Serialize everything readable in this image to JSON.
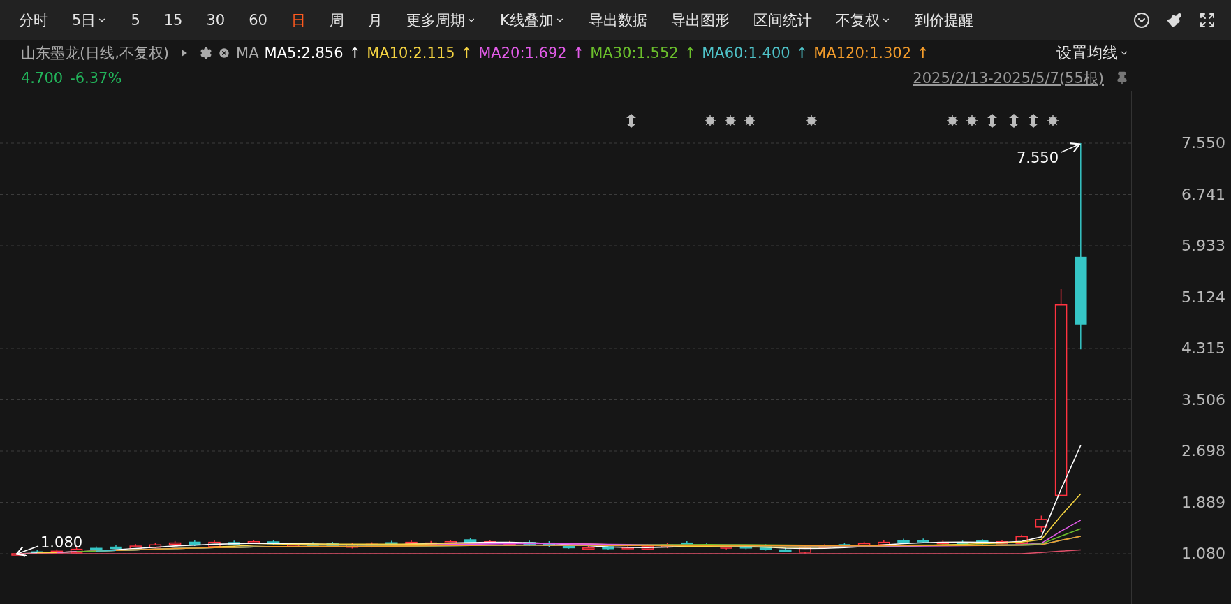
{
  "toolbar": {
    "items": [
      {
        "label": "分时",
        "selected": false,
        "dropdown": false
      },
      {
        "label": "5日",
        "selected": false,
        "dropdown": true
      },
      {
        "label": "5",
        "selected": false,
        "dropdown": false
      },
      {
        "label": "15",
        "selected": false,
        "dropdown": false
      },
      {
        "label": "30",
        "selected": false,
        "dropdown": false
      },
      {
        "label": "60",
        "selected": false,
        "dropdown": false
      },
      {
        "label": "日",
        "selected": true,
        "dropdown": false
      },
      {
        "label": "周",
        "selected": false,
        "dropdown": false
      },
      {
        "label": "月",
        "selected": false,
        "dropdown": false
      },
      {
        "label": "更多周期",
        "selected": false,
        "dropdown": true
      },
      {
        "label": "K线叠加",
        "selected": false,
        "dropdown": true
      },
      {
        "label": "导出数据",
        "selected": false,
        "dropdown": false
      },
      {
        "label": "导出图形",
        "selected": false,
        "dropdown": false
      },
      {
        "label": "区间统计",
        "selected": false,
        "dropdown": false
      },
      {
        "label": "不复权",
        "selected": false,
        "dropdown": true
      },
      {
        "label": "到价提醒",
        "selected": false,
        "dropdown": false
      }
    ]
  },
  "legend": {
    "title": "山东墨龙(日线,不复权)",
    "indicator": "MA",
    "setting": "设置均线",
    "ma": [
      {
        "label": "MA5:2.856",
        "arrow": "↑",
        "color": "#ffffff"
      },
      {
        "label": "MA10:2.115",
        "arrow": "↑",
        "color": "#f5d442"
      },
      {
        "label": "MA20:1.692",
        "arrow": "↑",
        "color": "#e25ce8"
      },
      {
        "label": "MA30:1.552",
        "arrow": "↑",
        "color": "#6bbf2c"
      },
      {
        "label": "MA60:1.400",
        "arrow": "↑",
        "color": "#4fc3c9"
      },
      {
        "label": "MA120:1.302",
        "arrow": "↑",
        "color": "#f39c2b"
      }
    ]
  },
  "quote": {
    "price": "4.700",
    "change": "-6.37%"
  },
  "range": "2025/2/13-2025/5/7(55根)",
  "chart": {
    "high_label": "7.550",
    "low_label": "1.080",
    "y_labels": [
      "7.550",
      "6.741",
      "5.933",
      "5.124",
      "4.315",
      "3.506",
      "2.698",
      "1.889",
      "1.080"
    ],
    "markers": [
      {
        "kind": "arrows"
      },
      {
        "kind": "sun"
      },
      {
        "kind": "sun"
      },
      {
        "kind": "sun"
      },
      {
        "kind": "sun"
      },
      {
        "kind": "sun"
      },
      {
        "kind": "sun"
      },
      {
        "kind": "arrows"
      },
      {
        "kind": "arrows"
      },
      {
        "kind": "arrows"
      },
      {
        "kind": "sun"
      }
    ]
  }
}
